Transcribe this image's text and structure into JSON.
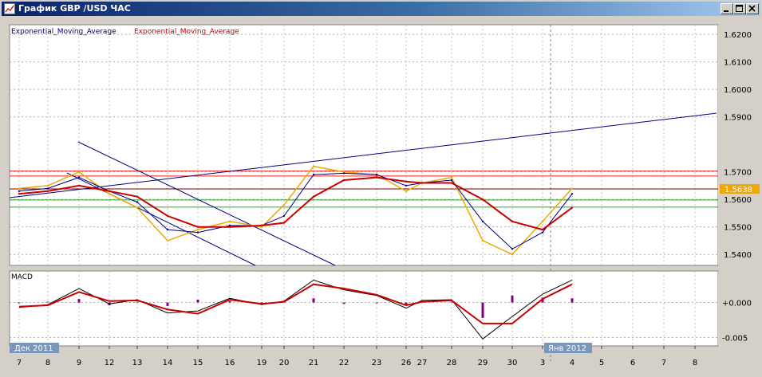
{
  "window": {
    "title": "График GBP /USD  ЧАС",
    "controls": {
      "minimize": "minimize",
      "maximize": "maximize",
      "close": "close"
    }
  },
  "main_chart": {
    "legend": [
      "Exponential_Moving_Average",
      "Exponential_Moving_Average"
    ],
    "price_labels": [
      "1.6200",
      "1.6100",
      "1.6000",
      "1.5900",
      "1.5700",
      "1.5600",
      "1.5500",
      "1.5400"
    ],
    "current_price": "1.5638"
  },
  "macd_panel": {
    "label": "MACD",
    "value_labels": [
      "+0.000",
      "-0.005"
    ]
  },
  "x_axis": {
    "ticks": [
      "7",
      "8",
      "9",
      "12",
      "13",
      "14",
      "15",
      "16",
      "19",
      "20",
      "21",
      "22",
      "23",
      "26",
      "27",
      "28",
      "29",
      "30",
      "3",
      "4",
      "5",
      "6",
      "7",
      "8"
    ],
    "period_labels": [
      "Дек 2011",
      "Янв 2012"
    ]
  },
  "colors": {
    "price": "#f0a800",
    "ema_fast": "#000080",
    "ema_slow": "#cc0000",
    "macd_hist": "#800080",
    "resistance": "#ee2222",
    "support": "#22aa22",
    "trendline": "#000080",
    "title_bar": "#0a246a"
  },
  "chart_data": {
    "type": "line",
    "ylim": [
      1.536,
      1.6235
    ],
    "macd_ylim": [
      -0.0062,
      0.0045
    ],
    "x": [
      "7",
      "8",
      "9",
      "12",
      "13",
      "14",
      "15",
      "16",
      "19",
      "20",
      "21",
      "22",
      "23",
      "26",
      "27",
      "28",
      "29",
      "30",
      "3",
      "4"
    ],
    "series": [
      {
        "values": [
          1.564,
          1.565,
          1.57,
          1.562,
          1.557,
          1.545,
          1.549,
          1.552,
          1.55,
          1.558,
          1.572,
          1.57,
          1.569,
          1.563,
          1.566,
          1.568,
          1.545,
          1.54,
          1.552,
          1.564
        ]
      },
      {
        "values": [
          1.563,
          1.564,
          1.568,
          1.563,
          1.559,
          1.549,
          1.548,
          1.5505,
          1.5505,
          1.554,
          1.569,
          1.5695,
          1.569,
          1.565,
          1.566,
          1.567,
          1.552,
          1.542,
          1.548,
          1.562
        ]
      },
      {
        "values": [
          1.562,
          1.563,
          1.565,
          1.563,
          1.561,
          1.554,
          1.55,
          1.55,
          1.5505,
          1.5515,
          1.561,
          1.567,
          1.568,
          1.5665,
          1.566,
          1.566,
          1.56,
          1.552,
          1.549,
          1.557
        ]
      }
    ],
    "horizontal_levels": {
      "resistance": [
        1.5703,
        1.5685
      ],
      "support": [
        1.5598,
        1.5572
      ],
      "current": 1.5638
    },
    "macd": {
      "macd_line": [
        -0.0007,
        -0.0003,
        0.002,
        -0.0002,
        0.0004,
        -0.0015,
        -0.0012,
        0.0006,
        -0.0003,
        0.0002,
        0.0032,
        0.0018,
        0.001,
        -0.0008,
        0.0003,
        0.0004,
        -0.0052,
        -0.002,
        0.0012,
        0.0032
      ],
      "signal_line": [
        -0.0006,
        -0.0004,
        0.0015,
        0.0002,
        0.0003,
        -0.001,
        -0.0016,
        0.0004,
        -0.0002,
        0.0001,
        0.0026,
        0.002,
        0.0011,
        -0.0004,
        0.0001,
        0.0003,
        -0.003,
        -0.003,
        0.0005,
        0.0026
      ]
    }
  }
}
